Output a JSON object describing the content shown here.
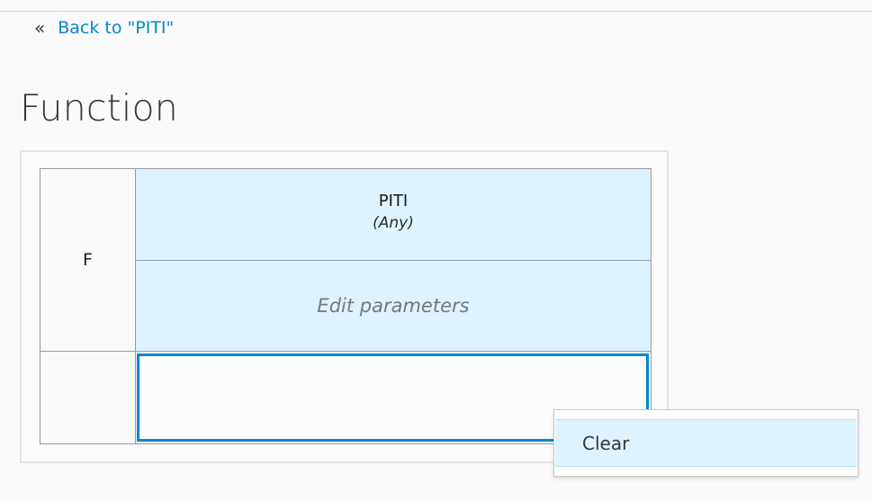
{
  "nav": {
    "back_icon": "«",
    "back_label": "Back to \"PITI\""
  },
  "page": {
    "title": "Function"
  },
  "function_grid": {
    "name": "F",
    "parameter": {
      "name": "PITI",
      "type": "(Any)"
    },
    "edit_parameters_label": "Edit parameters"
  },
  "context_menu": {
    "items": [
      {
        "label": "Clear"
      }
    ]
  },
  "colors": {
    "accent": "#0088ce",
    "header_bg": "#def3ff"
  }
}
